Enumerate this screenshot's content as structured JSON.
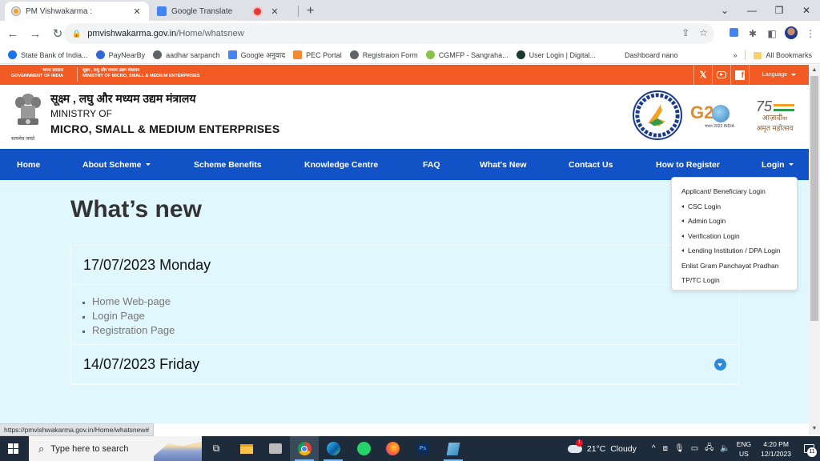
{
  "browser": {
    "tabs": [
      {
        "title": "PM Vishwakarma :",
        "active": true
      },
      {
        "title": "Google Translate",
        "active": false,
        "recording": true
      }
    ],
    "new_tab_label": "+",
    "address": {
      "host": "pmvishwakarma.gov.in",
      "path": "/Home/whatsnew"
    },
    "bookmarks": [
      {
        "label": "State Bank of India...",
        "icon_color": "#1a73e8"
      },
      {
        "label": "PayNearBy",
        "icon_color": "#3367d6"
      },
      {
        "label": "aadhar sarpanch",
        "icon_color": "#5f6368"
      },
      {
        "label": "Google अनुवाद",
        "icon_color": "#4285f4"
      },
      {
        "label": "PEC Portal",
        "icon_color": "#f28b30"
      },
      {
        "label": "Registraion Form",
        "icon_color": "#5f6368"
      },
      {
        "label": "CGMFP - Sangraha...",
        "icon_color": "#8bc34a"
      },
      {
        "label": "User Login | Digital...",
        "icon_color": "#1b3a2f"
      },
      {
        "label": "Dashboard nano",
        "icon_color": ""
      }
    ],
    "bookmarks_overflow": "»",
    "all_bookmarks_label": "All Bookmarks",
    "status_url": "https://pmvishwakarma.gov.in/Home/whatsnew#"
  },
  "site": {
    "topbar": {
      "gov_hindi": "भारत सरकार",
      "gov_english": "GOVERNMENT OF INDIA",
      "ministry_hindi": "सूक्ष्म , लघु और मध्यम उद्यम मंत्रालय",
      "ministry_english": "MINISTRY OF MICRO, SMALL & MEDIUM ENTERPRISES",
      "language_label": "Language",
      "color": "#f15a22"
    },
    "header": {
      "hindi_title": "सूक्ष्म , लघु और मध्यम उद्यम मंत्रालय",
      "ministry_of": "MINISTRY OF",
      "msme": "MICRO, SMALL & MEDIUM ENTERPRISES",
      "emblem_caption": "सत्यमेव जयते",
      "g20_text": "G2",
      "g20_sub": "भारत 2023 INDIA",
      "azadi_line1": "आज़ादी",
      "azadi_suffix": "का",
      "azadi_line2": "अमृत महोत्सव",
      "azadi_75": "75"
    },
    "nav": {
      "color": "#1153c6",
      "items": [
        {
          "label": "Home",
          "dropdown": false
        },
        {
          "label": "About Scheme",
          "dropdown": true
        },
        {
          "label": "Scheme Benefits",
          "dropdown": false
        },
        {
          "label": "Knowledge Centre",
          "dropdown": false
        },
        {
          "label": "FAQ",
          "dropdown": false
        },
        {
          "label": "What's New",
          "dropdown": false
        },
        {
          "label": "Contact Us",
          "dropdown": false
        },
        {
          "label": "How to Register",
          "dropdown": false
        },
        {
          "label": "Login",
          "dropdown": true
        }
      ]
    },
    "login_menu": [
      {
        "label": "Applicant/ Beneficiary Login",
        "submenu": false
      },
      {
        "label": "CSC Login",
        "submenu": true
      },
      {
        "label": "Admin Login",
        "submenu": true
      },
      {
        "label": "Verification Login",
        "submenu": true
      },
      {
        "label": "Lending Institution / DPA Login",
        "submenu": true
      },
      {
        "label": "Enlist Gram Panchayat Pradhan",
        "submenu": false
      },
      {
        "label": "TP/TC Login",
        "submenu": false
      }
    ],
    "page_title": "What’s new",
    "updates": [
      {
        "date": "17/07/2023 Monday",
        "expanded": true,
        "items": [
          "Home Web-page",
          "Login Page",
          "Registration Page"
        ]
      },
      {
        "date": "14/07/2023 Friday",
        "expanded": false,
        "items": []
      }
    ]
  },
  "taskbar": {
    "search_placeholder": "Type here to search",
    "weather": "21°C  Cloudy",
    "weather_badge": "1",
    "lang_top": "ENG",
    "lang_bottom": "US",
    "time": "4:20 PM",
    "date": "12/1/2023",
    "notification_count": "11"
  }
}
